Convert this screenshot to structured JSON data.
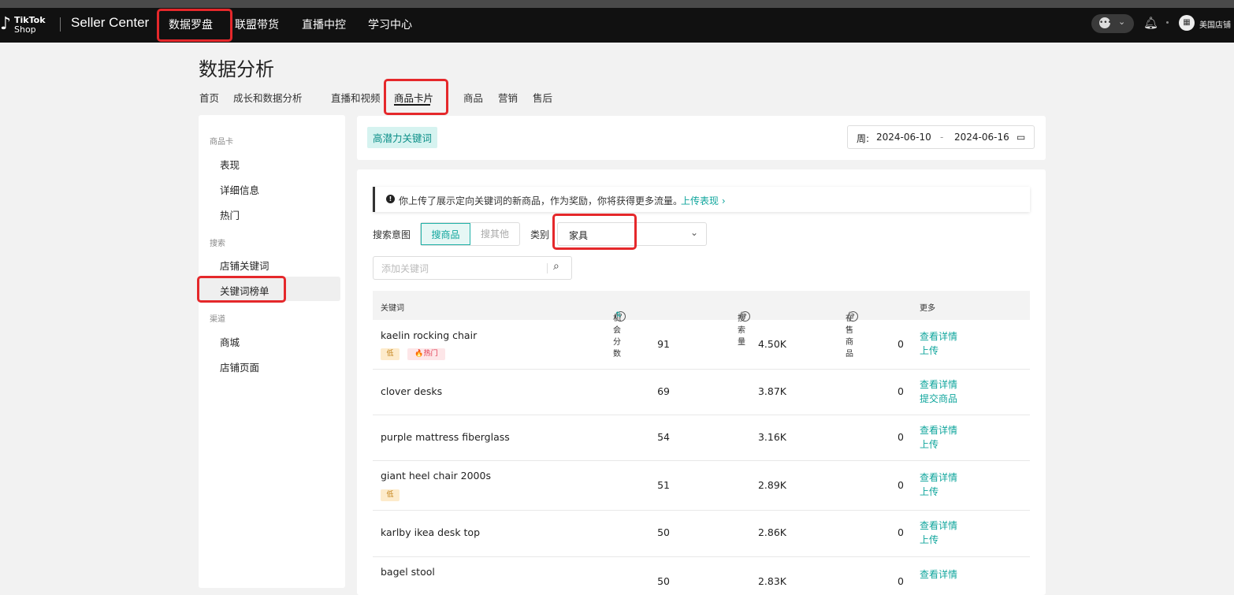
{
  "topbar": {
    "brand_line1": "TikTok",
    "brand_line2": "Shop",
    "product": "Seller Center",
    "nav": [
      "数据罗盘",
      "联盟带货",
      "直播中控",
      "学习中心"
    ],
    "store_name": "美国店铺"
  },
  "page": {
    "title": "数据分析",
    "tabs": [
      "首页",
      "成长和数据分析",
      "直播和视频",
      "商品卡片",
      "商品",
      "营销",
      "售后"
    ],
    "active_tab": "商品卡片"
  },
  "sidebar": {
    "groups": [
      {
        "label": "商品卡",
        "items": [
          "表现",
          "详细信息",
          "热门"
        ]
      },
      {
        "label": "搜索",
        "items": [
          "店铺关键词",
          "关键词榜单"
        ]
      },
      {
        "label": "渠道",
        "items": [
          "商城",
          "店铺页面"
        ]
      }
    ],
    "active_item": "关键词榜单"
  },
  "filter_bar": {
    "tag": "高潜力关键词",
    "date_prefix": "周:",
    "date_start": "2024-06-10",
    "date_sep": "-",
    "date_end": "2024-06-16"
  },
  "notice": {
    "text": "你上传了展示定向关键词的新商品，作为奖励，你将获得更多流量。",
    "link": "上传表现 ›"
  },
  "controls": {
    "intent_label": "搜索意图",
    "intent_options": [
      "搜商品",
      "搜其他"
    ],
    "category_label": "类别",
    "category_value": "家具",
    "search_placeholder": "添加关键词"
  },
  "table": {
    "headers": {
      "keyword": "关键词",
      "score": "机会分数",
      "volume": "搜索量",
      "on_sale": "在售商品",
      "more": "更多"
    },
    "rows": [
      {
        "keyword": "kaelin rocking chair",
        "badges": [
          "低",
          "🔥热门"
        ],
        "score": "91",
        "volume": "4.50K",
        "on_sale": "0",
        "actions": [
          "查看详情",
          "上传"
        ]
      },
      {
        "keyword": "clover desks",
        "badges": [],
        "score": "69",
        "volume": "3.87K",
        "on_sale": "0",
        "actions": [
          "查看详情",
          "提交商品"
        ]
      },
      {
        "keyword": "purple mattress fiberglass",
        "badges": [],
        "score": "54",
        "volume": "3.16K",
        "on_sale": "0",
        "actions": [
          "查看详情",
          "上传"
        ]
      },
      {
        "keyword": "giant heel chair 2000s",
        "badges": [
          "低"
        ],
        "score": "51",
        "volume": "2.89K",
        "on_sale": "0",
        "actions": [
          "查看详情",
          "上传"
        ]
      },
      {
        "keyword": "karlby ikea desk top",
        "badges": [],
        "score": "50",
        "volume": "2.86K",
        "on_sale": "0",
        "actions": [
          "查看详情",
          "上传"
        ]
      },
      {
        "keyword": "bagel stool",
        "badges": [],
        "score": "50",
        "volume": "2.83K",
        "on_sale": "0",
        "actions": [
          "查看详情"
        ]
      }
    ]
  },
  "colors": {
    "accent": "#0fa59c",
    "highlight": "#e5282b",
    "topbar": "#111111"
  }
}
